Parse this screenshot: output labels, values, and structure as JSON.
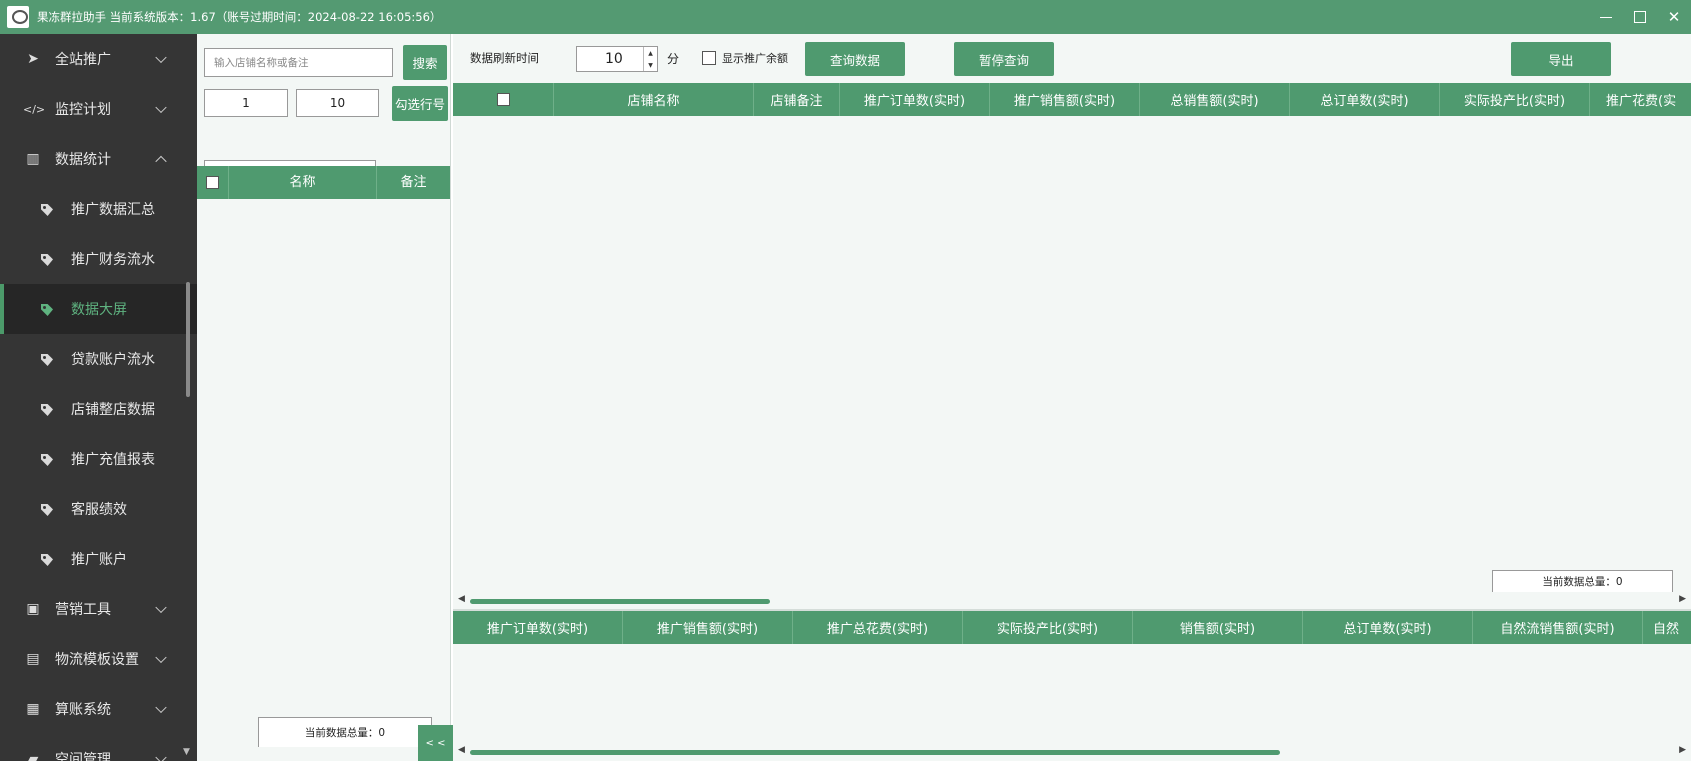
{
  "app": {
    "title": "果冻群拉助手 当前系统版本：1.67（账号过期时间：2024-08-22 16:05:56）",
    "window_buttons": {
      "minimize": "",
      "maximize": "",
      "close": "✕"
    }
  },
  "sidebar": {
    "items": [
      {
        "label": "全站推广",
        "icon": "navigation-arrow-icon",
        "glyph": "➤",
        "expanded": false
      },
      {
        "label": "监控计划",
        "icon": "code-icon",
        "glyph": "</>",
        "expanded": false
      },
      {
        "label": "数据统计",
        "icon": "bar-chart-icon",
        "glyph": "▥",
        "expanded": true
      }
    ],
    "sub_items": [
      {
        "label": "推广数据汇总",
        "active": false
      },
      {
        "label": "推广财务流水",
        "active": false
      },
      {
        "label": "数据大屏",
        "active": true
      },
      {
        "label": "贷款账户流水",
        "active": false
      },
      {
        "label": "店铺整店数据",
        "active": false
      },
      {
        "label": "推广充值报表",
        "active": false
      },
      {
        "label": "客服绩效",
        "active": false
      },
      {
        "label": "推广账户",
        "active": false
      }
    ],
    "bottom_items": [
      {
        "label": "营销工具",
        "icon": "contact-card-icon",
        "glyph": "▣"
      },
      {
        "label": "物流模板设置",
        "icon": "briefcase-icon",
        "glyph": "▤"
      },
      {
        "label": "算账系统",
        "icon": "bank-icon",
        "glyph": "▦"
      },
      {
        "label": "空间管理",
        "icon": "folder-icon",
        "glyph": "▰"
      }
    ]
  },
  "left_panel": {
    "search_placeholder": "输入店铺名称或备注",
    "search_button": "搜索",
    "range_from": "1",
    "range_to": "10",
    "select_button": "勾选行号",
    "dropdown_value": "",
    "columns": [
      "名称",
      "备注"
    ],
    "count_label": "当前数据总量：0",
    "collapse_label": "< <"
  },
  "toolbar": {
    "refresh_label": "数据刷新时间",
    "refresh_value": "10",
    "unit": "分",
    "show_balance_label": "显示推广余额",
    "query_button": "查询数据",
    "pause_button": "暂停查询",
    "export_button": "导出"
  },
  "top_grid": {
    "columns": [
      "店铺名称",
      "店铺备注",
      "推广订单数(实时)",
      "推广销售额(实时)",
      "总销售额(实时)",
      "总订单数(实时)",
      "实际投产比(实时)",
      "推广花费(实"
    ],
    "count_label": "当前数据总量：0"
  },
  "bottom_grid": {
    "columns": [
      "推广订单数(实时)",
      "推广销售额(实时)",
      "推广总花费(实时)",
      "实际投产比(实时)",
      "销售额(实时)",
      "总订单数(实时)",
      "自然流销售额(实时)",
      "自然"
    ]
  },
  "colors": {
    "accent": "#4f9a6f",
    "titlebar": "#549a72",
    "sidebar_bg": "#353535",
    "active_text": "#5fb380"
  }
}
